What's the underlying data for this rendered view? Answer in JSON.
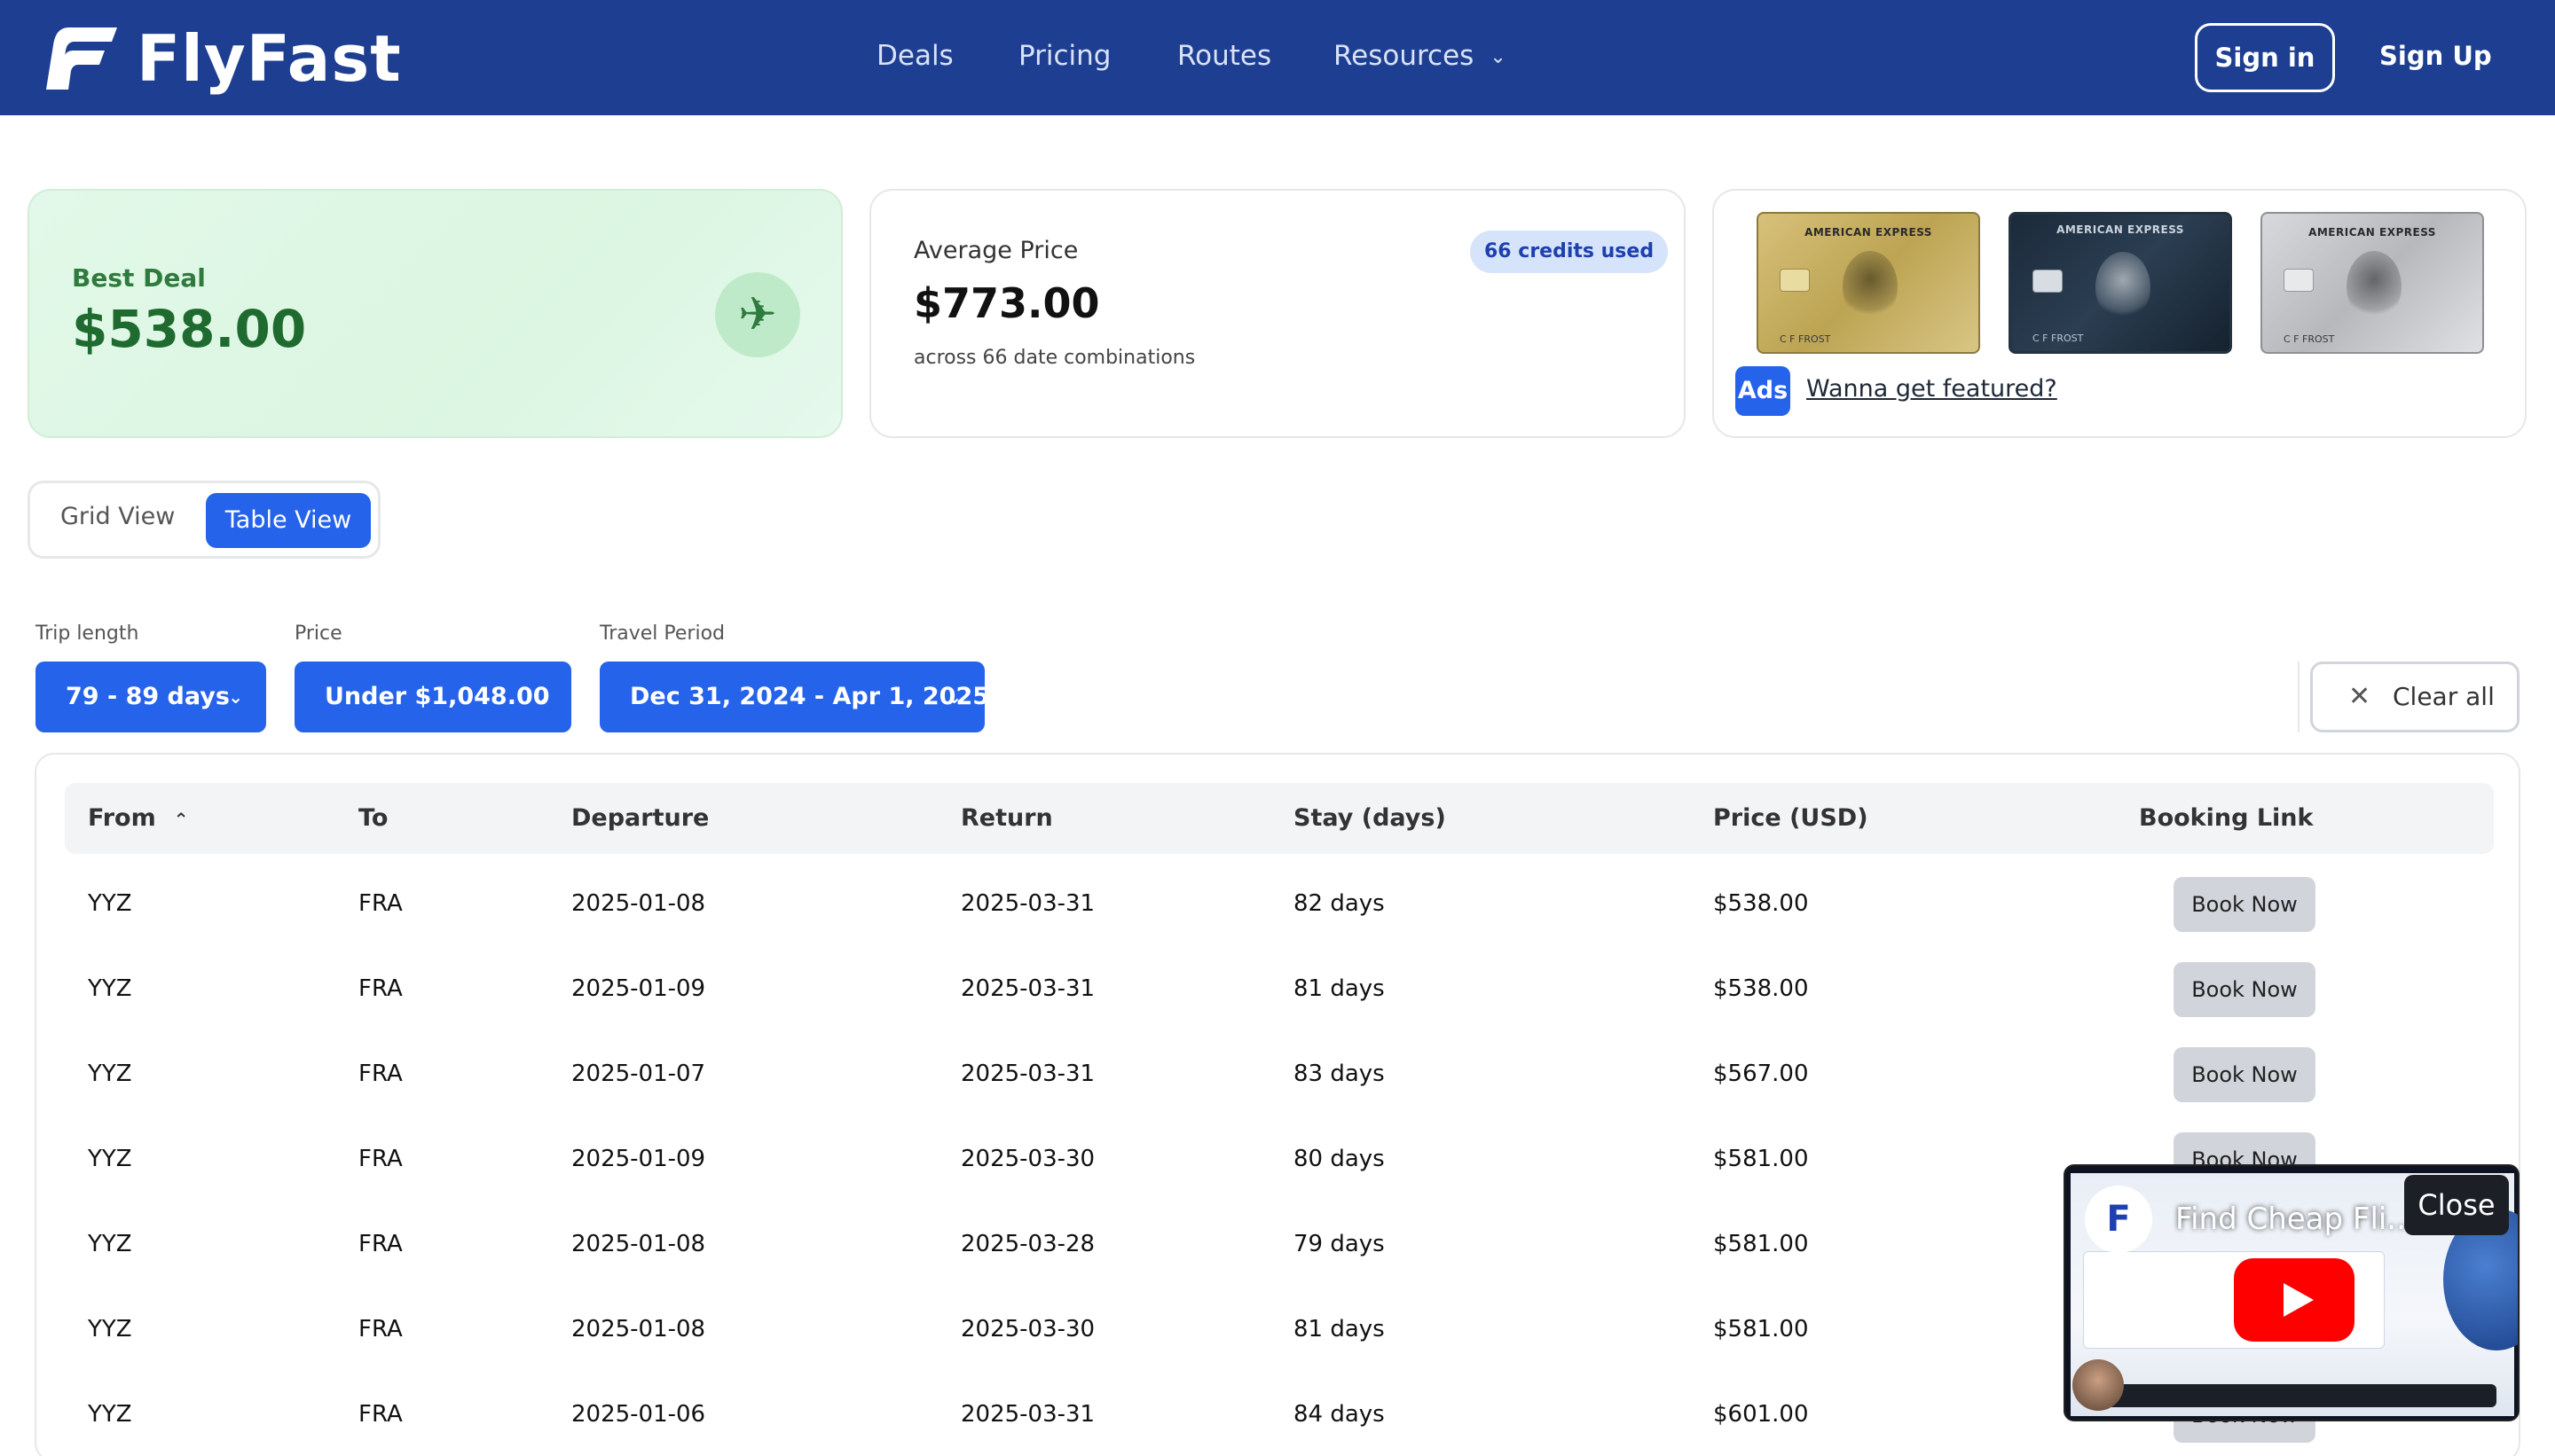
{
  "header": {
    "brand": "FlyFast",
    "nav": [
      {
        "label": "Deals"
      },
      {
        "label": "Pricing"
      },
      {
        "label": "Routes"
      },
      {
        "label": "Resources",
        "has_dropdown": true
      }
    ],
    "sign_in": "Sign in",
    "sign_up": "Sign Up",
    "colors": {
      "header_bg": "#1e3f91",
      "accent": "#2563eb"
    }
  },
  "cards": {
    "best_deal": {
      "label": "Best Deal",
      "value": "$538.00",
      "icon": "airplane-icon"
    },
    "average": {
      "label": "Average Price",
      "value": "$773.00",
      "subtitle": "across 66 date combinations",
      "badge": "66 credits used"
    },
    "ads": {
      "badge": "Ads",
      "link": "Wanna get featured?",
      "cards": [
        {
          "title": "AMERICAN EXPRESS",
          "name": "C F FROST"
        },
        {
          "title": "AMERICAN EXPRESS",
          "name": "C F FROST"
        },
        {
          "title": "AMERICAN EXPRESS",
          "name": "C F FROST"
        }
      ]
    }
  },
  "view_toggle": {
    "grid": "Grid View",
    "table": "Table View",
    "active": "table"
  },
  "filters": {
    "trip_length": {
      "label": "Trip length",
      "value": "79 - 89 days"
    },
    "price": {
      "label": "Price",
      "value": "Under $1,048.00"
    },
    "travel_period": {
      "label": "Travel Period",
      "value": "Dec 31, 2024 - Apr 1, 2025"
    },
    "clear_all": "Clear all"
  },
  "table": {
    "columns": [
      "From",
      "To",
      "Departure",
      "Return",
      "Stay (days)",
      "Price (USD)",
      "Booking Link"
    ],
    "sorted_column": "From",
    "sort_direction": "ascending",
    "book_label": "Book Now",
    "rows": [
      {
        "from": "YYZ",
        "to": "FRA",
        "departure": "2025-01-08",
        "return": "2025-03-31",
        "stay": "82 days",
        "price": "$538.00"
      },
      {
        "from": "YYZ",
        "to": "FRA",
        "departure": "2025-01-09",
        "return": "2025-03-31",
        "stay": "81 days",
        "price": "$538.00"
      },
      {
        "from": "YYZ",
        "to": "FRA",
        "departure": "2025-01-07",
        "return": "2025-03-31",
        "stay": "83 days",
        "price": "$567.00"
      },
      {
        "from": "YYZ",
        "to": "FRA",
        "departure": "2025-01-09",
        "return": "2025-03-30",
        "stay": "80 days",
        "price": "$581.00"
      },
      {
        "from": "YYZ",
        "to": "FRA",
        "departure": "2025-01-08",
        "return": "2025-03-28",
        "stay": "79 days",
        "price": "$581.00"
      },
      {
        "from": "YYZ",
        "to": "FRA",
        "departure": "2025-01-08",
        "return": "2025-03-30",
        "stay": "81 days",
        "price": "$581.00"
      },
      {
        "from": "YYZ",
        "to": "FRA",
        "departure": "2025-01-06",
        "return": "2025-03-31",
        "stay": "84 days",
        "price": "$601.00"
      }
    ]
  },
  "video": {
    "title": "Find Cheap Fli...",
    "close": "Close"
  }
}
